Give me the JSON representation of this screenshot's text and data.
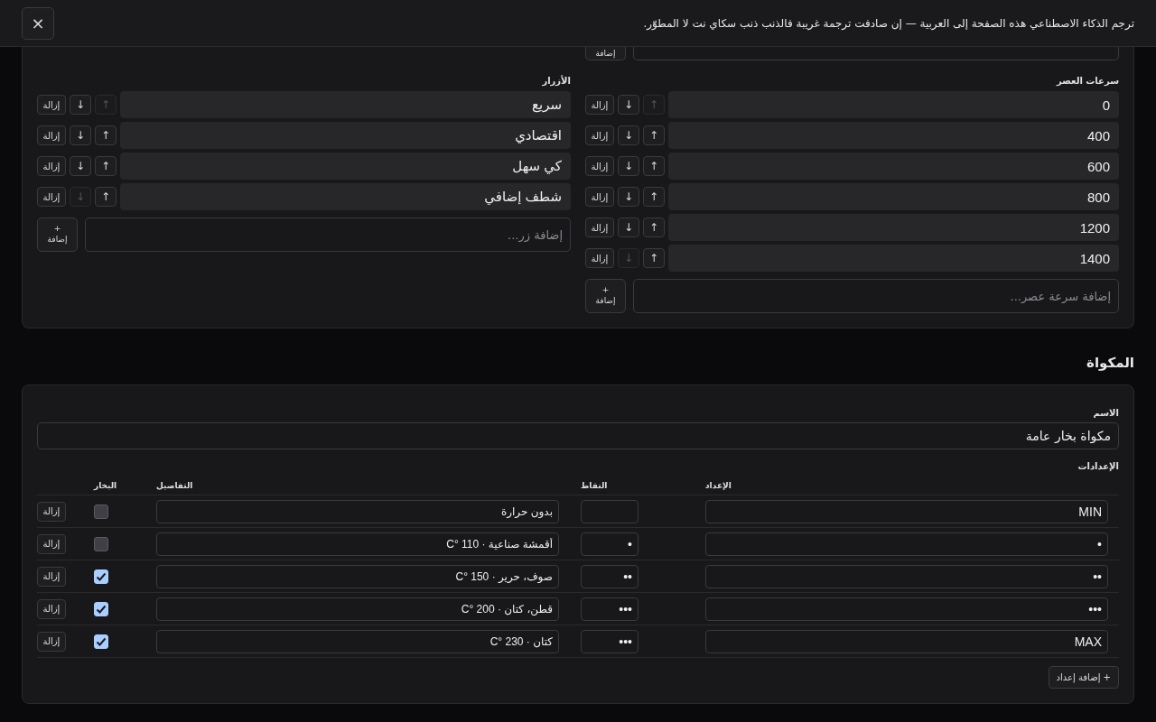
{
  "banner": {
    "text": "ترجم الذكاء الاصطناعي هذه الصفحة إلى العربية — إن صادفت ترجمة غريبة فالذنب ذنب سكاي نت لا المطوّر.",
    "close": "×"
  },
  "top_add_button": "إضافة",
  "speeds": {
    "label": "سرعات العصر",
    "items": [
      {
        "value": "0",
        "up_disabled": true,
        "down_disabled": false,
        "remove": "إزالة"
      },
      {
        "value": "400",
        "up_disabled": false,
        "down_disabled": false,
        "remove": "إزالة"
      },
      {
        "value": "600",
        "up_disabled": false,
        "down_disabled": false,
        "remove": "إزالة"
      },
      {
        "value": "800",
        "up_disabled": false,
        "down_disabled": false,
        "remove": "إزالة"
      },
      {
        "value": "1200",
        "up_disabled": false,
        "down_disabled": false,
        "remove": "إزالة"
      },
      {
        "value": "1400",
        "up_disabled": false,
        "down_disabled": true,
        "remove": "إزالة"
      }
    ],
    "up": "↑",
    "down": "↓",
    "add_placeholder": "إضافة سرعة عصر...",
    "add_plus": "+",
    "add_button": "إضافة"
  },
  "buttons": {
    "label": "الأزرار",
    "items": [
      {
        "value": "سريع",
        "up_disabled": true,
        "down_disabled": false,
        "remove": "إزالة"
      },
      {
        "value": "اقتصادي",
        "up_disabled": false,
        "down_disabled": false,
        "remove": "إزالة"
      },
      {
        "value": "كي سهل",
        "up_disabled": false,
        "down_disabled": false,
        "remove": "إزالة"
      },
      {
        "value": "شطف إضافي",
        "up_disabled": false,
        "down_disabled": true,
        "remove": "إزالة"
      }
    ],
    "up": "↑",
    "down": "↓",
    "add_placeholder": "إضافة زر...",
    "add_plus": "+",
    "add_button": "إضافة"
  },
  "iron": {
    "title": "المكواة",
    "name_label": "الاسم",
    "name_value": "مكواة بخار عامة",
    "settings_label": "الإعدادات",
    "columns": [
      "الإعداد",
      "النقاط",
      "التفاصيل",
      "البخار"
    ],
    "rows": [
      {
        "setting": "MIN",
        "points": "",
        "details": "بدون حرارة",
        "steam": false,
        "remove": "إزالة"
      },
      {
        "setting": "•",
        "points": "•",
        "details": "أقمشة صناعية · 110 °C",
        "steam": false,
        "remove": "إزالة"
      },
      {
        "setting": "••",
        "points": "••",
        "details": "صوف، حرير · 150 °C",
        "steam": true,
        "remove": "إزالة"
      },
      {
        "setting": "•••",
        "points": "•••",
        "details": "قطن، كتان · 200 °C",
        "steam": true,
        "remove": "إزالة"
      },
      {
        "setting": "MAX",
        "points": "•••",
        "details": "كتان · 230 °C",
        "steam": true,
        "remove": "إزالة"
      }
    ],
    "add_button": "+ إضافة إعداد"
  }
}
